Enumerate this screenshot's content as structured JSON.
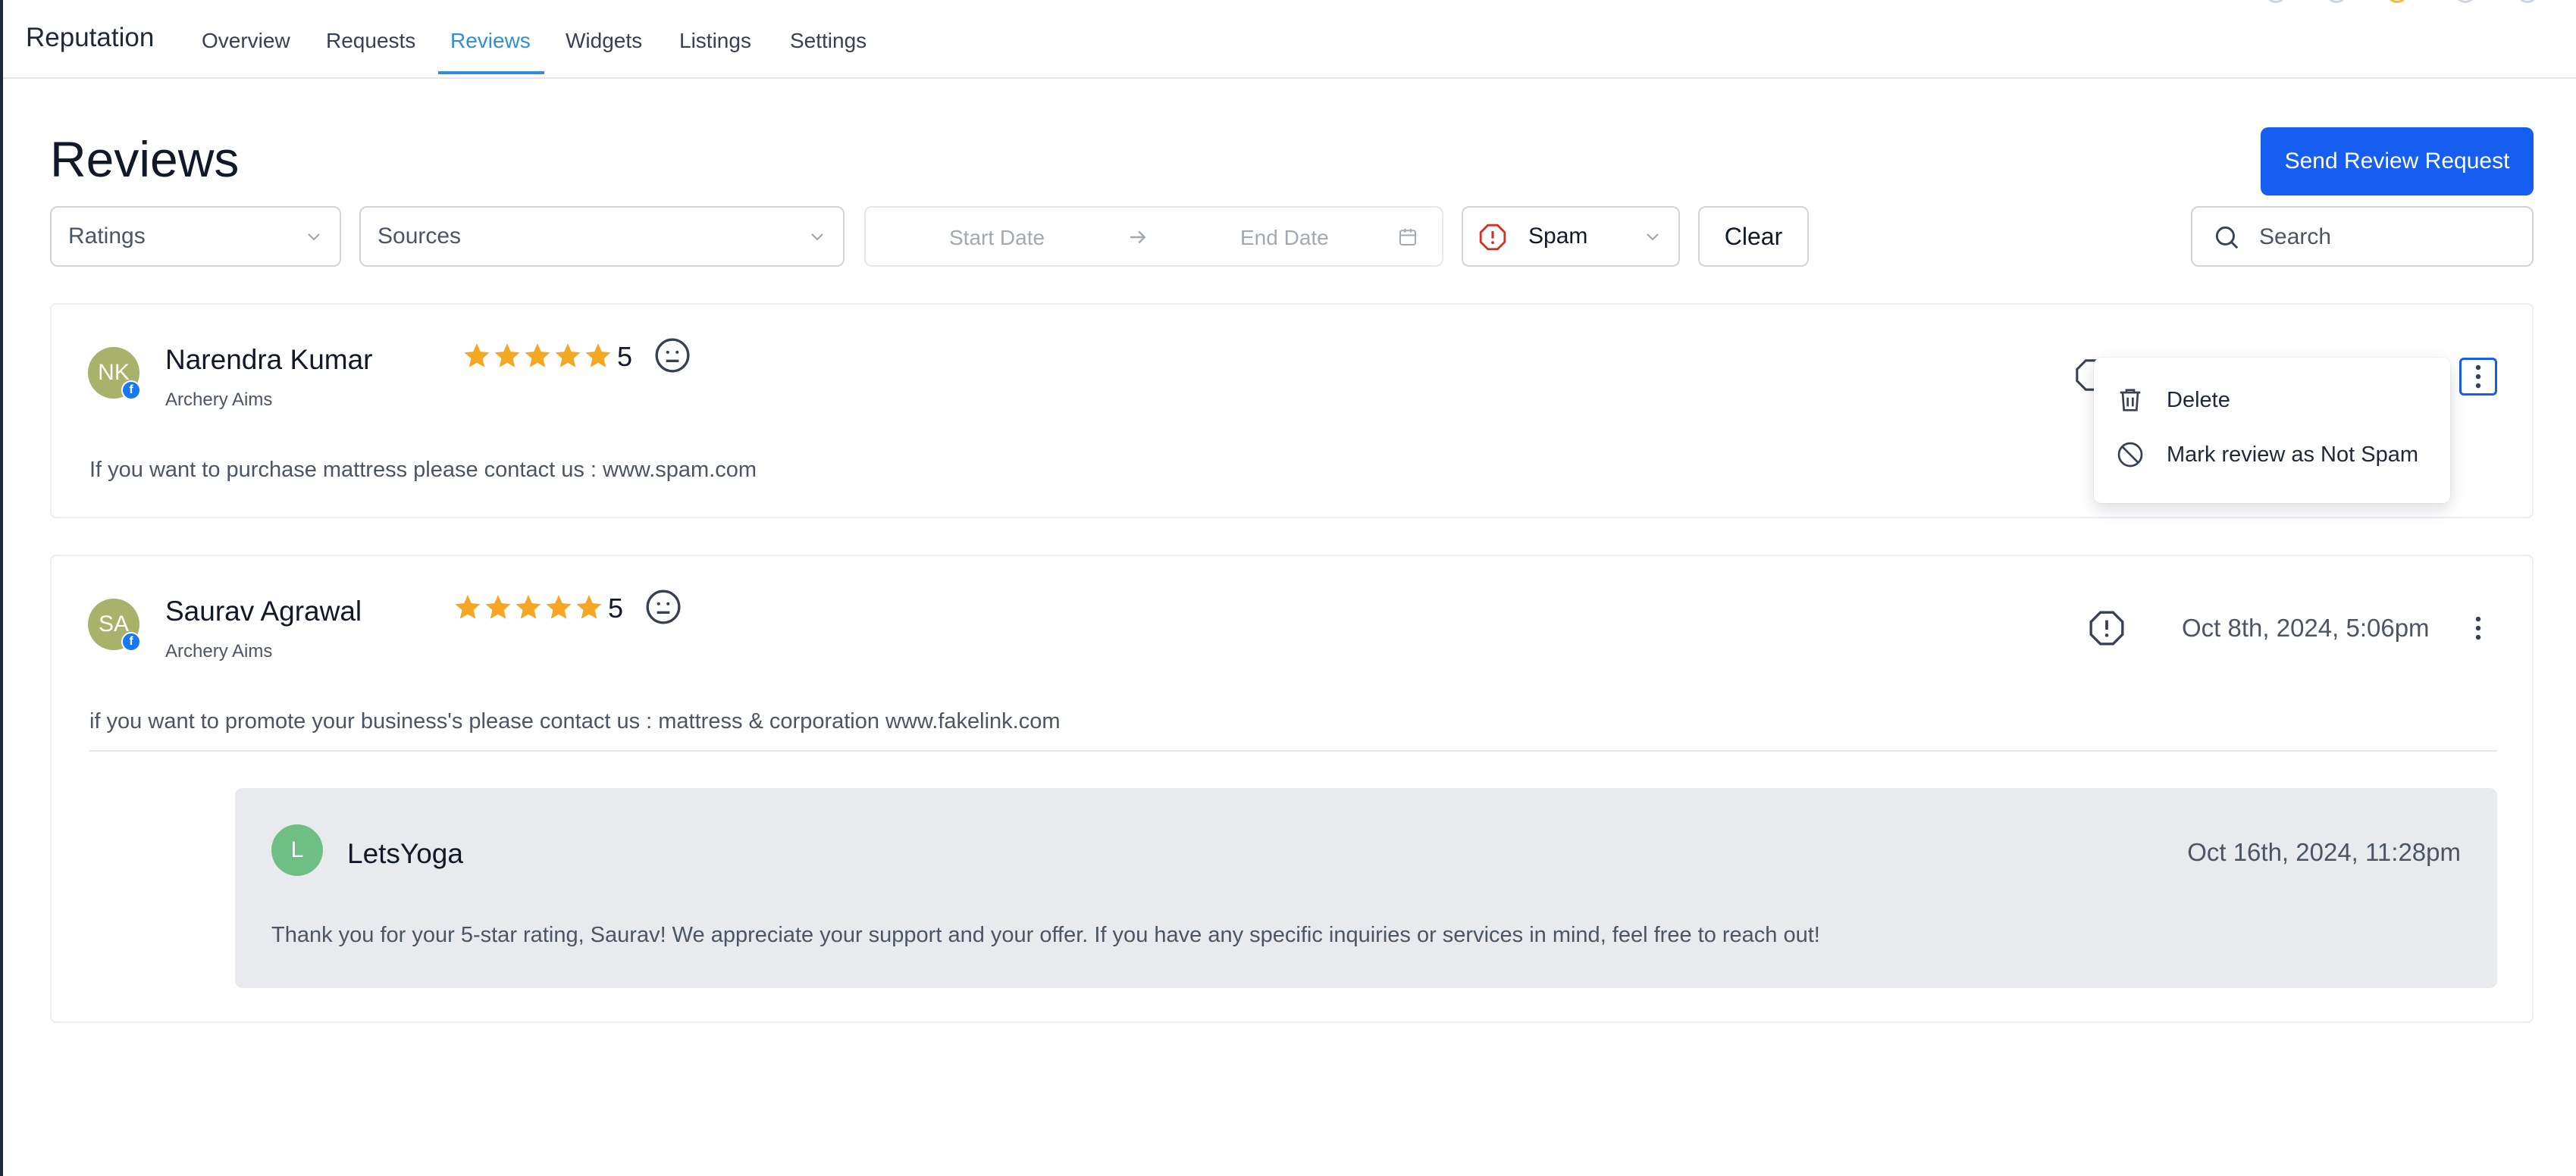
{
  "app": {
    "title": "Reputation"
  },
  "nav": {
    "tabs": [
      {
        "label": "Overview"
      },
      {
        "label": "Requests"
      },
      {
        "label": "Reviews",
        "active": true
      },
      {
        "label": "Widgets"
      },
      {
        "label": "Listings"
      },
      {
        "label": "Settings"
      }
    ]
  },
  "page": {
    "title": "Reviews",
    "primary_button": "Send Review Request"
  },
  "filters": {
    "ratings": "Ratings",
    "sources": "Sources",
    "start_date_placeholder": "Start Date",
    "end_date_placeholder": "End Date",
    "spam": "Spam",
    "clear": "Clear",
    "search_placeholder": "Search"
  },
  "reviews": [
    {
      "initials": "NK",
      "name": "Narendra Kumar",
      "location": "Archery Aims",
      "rating": "5",
      "stars": 5,
      "text": "If you want to purchase mattress please contact us : www.spam.com",
      "source_icon": "facebook-icon",
      "sentiment_icon": "neutral-face-icon"
    },
    {
      "initials": "SA",
      "name": "Saurav Agrawal",
      "location": "Archery Aims",
      "rating": "5",
      "stars": 5,
      "date": "Oct 8th, 2024, 5:06pm",
      "text": "if you want to promote your business's please contact us : mattress & corporation www.fakelink.com",
      "source_icon": "facebook-icon",
      "sentiment_icon": "neutral-face-icon",
      "reply": {
        "initial": "L",
        "name": "LetsYoga",
        "date": "Oct 16th, 2024, 11:28pm",
        "text": "Thank you for your 5-star rating, Saurav! We appreciate your support and your offer. If you have any specific inquiries or services in mind, feel free to reach out!"
      }
    }
  ],
  "menu": {
    "items": [
      {
        "label": "Delete",
        "icon": "trash-icon"
      },
      {
        "label": "Mark review as Not Spam",
        "icon": "ban-icon"
      }
    ]
  },
  "colors": {
    "accent": "#2f8fd6",
    "primary": "#155eef",
    "star": "#f5a623",
    "spam": "#d92d20"
  }
}
